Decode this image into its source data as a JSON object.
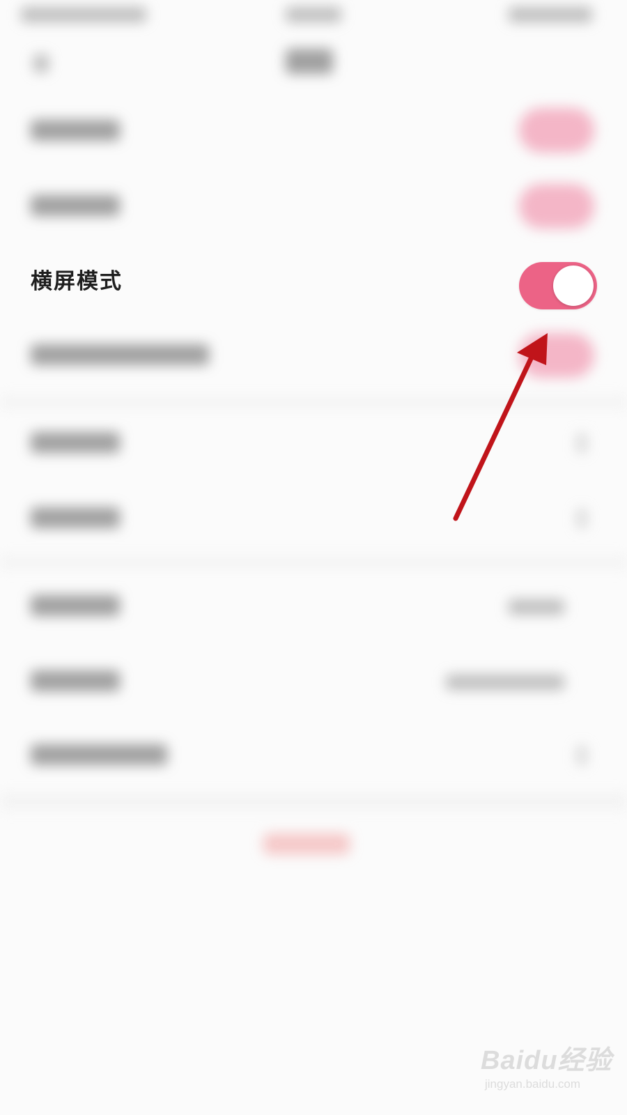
{
  "settings": {
    "landscape_mode": {
      "label": "横屏模式",
      "enabled": true
    }
  },
  "colors": {
    "toggle_on": "#ec6386",
    "annotation_arrow": "#c0141a",
    "background": "#fbfbfb"
  },
  "icons": {
    "annotation": "arrow-up-right-icon"
  },
  "watermark": {
    "logo": "Baidu经验",
    "url": "jingyan.baidu.com"
  }
}
